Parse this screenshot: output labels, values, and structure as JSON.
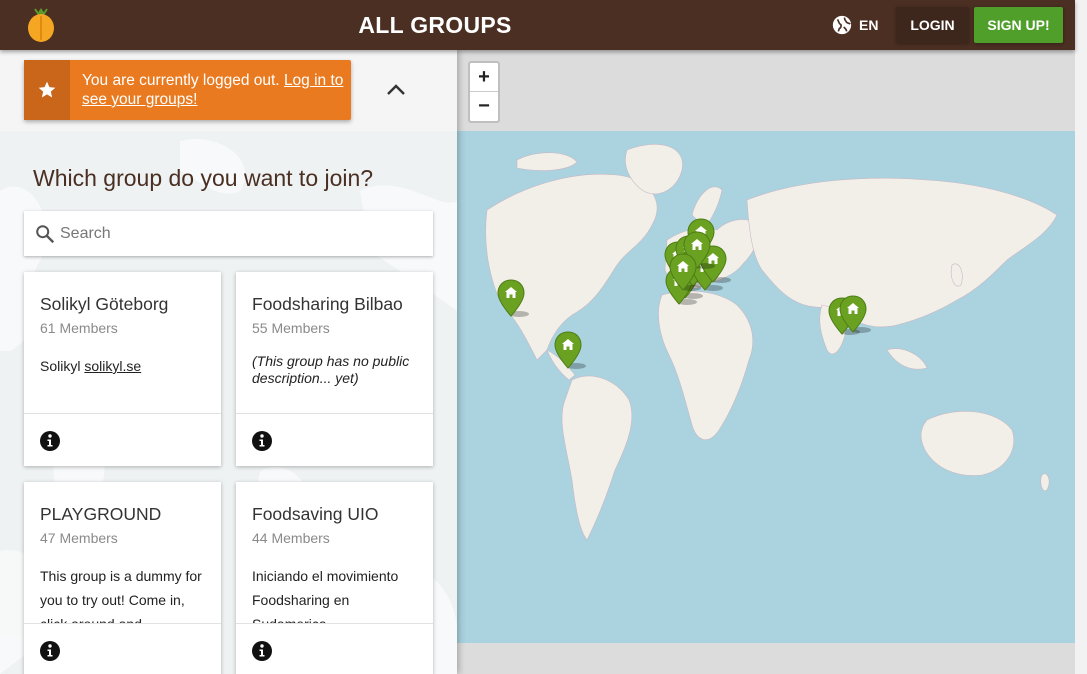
{
  "header": {
    "title": "ALL GROUPS",
    "language": "EN",
    "login_label": "LOGIN",
    "signup_label": "SIGN UP!"
  },
  "banner": {
    "text": "You are currently logged out. ",
    "link": "Log in to see your groups!"
  },
  "sidebar": {
    "question": "Which group do you want to join?",
    "search_placeholder": "Search"
  },
  "groups": [
    {
      "name": "Solikyl Göteborg",
      "members": "61 Members",
      "desc_prefix": "Solikyl ",
      "desc_link": "solikyl.se"
    },
    {
      "name": "Foodsharing Bilbao",
      "members": "55 Members",
      "desc": "(This group has no public description... yet)"
    },
    {
      "name": "PLAYGROUND",
      "members": "47 Members",
      "desc": "This group is a dummy for you to try out! Come in, click around and"
    },
    {
      "name": "Foodsaving UIO",
      "members": "44 Members",
      "desc": "Iniciando el movimiento Foodsharing en Sudamerica"
    }
  ],
  "map": {
    "zoom_in": "+",
    "zoom_out": "−",
    "marker_color": "#6aa121"
  },
  "colors": {
    "header": "#4a2f22",
    "banner": "#e97a1f",
    "signup": "#4f9f2a"
  }
}
